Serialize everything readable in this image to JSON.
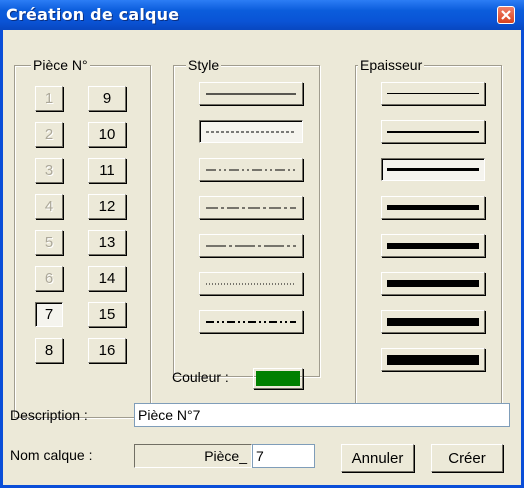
{
  "window": {
    "title": "Création de calque",
    "close_icon": "close-icon"
  },
  "piece": {
    "legend": "Pièce N°",
    "buttons": [
      {
        "label": "1",
        "disabled": true
      },
      {
        "label": "9",
        "disabled": false
      },
      {
        "label": "2",
        "disabled": true
      },
      {
        "label": "10",
        "disabled": false
      },
      {
        "label": "3",
        "disabled": true
      },
      {
        "label": "11",
        "disabled": false
      },
      {
        "label": "4",
        "disabled": true
      },
      {
        "label": "12",
        "disabled": false
      },
      {
        "label": "5",
        "disabled": true
      },
      {
        "label": "13",
        "disabled": false
      },
      {
        "label": "6",
        "disabled": true
      },
      {
        "label": "14",
        "disabled": false
      },
      {
        "label": "7",
        "disabled": false,
        "selected": true
      },
      {
        "label": "15",
        "disabled": false
      },
      {
        "label": "8",
        "disabled": false
      },
      {
        "label": "16",
        "disabled": false
      }
    ]
  },
  "style": {
    "legend": "Style",
    "options": [
      "solid",
      "dashed",
      "dash-dot-dot-long",
      "dash-dot",
      "long-dash-dot",
      "dotted",
      "dash-dot-dot-bold"
    ],
    "selected_index": 1
  },
  "epaisseur": {
    "legend": "Epaisseur",
    "options": [
      "1",
      "2",
      "3",
      "4",
      "5",
      "6",
      "7",
      "8"
    ],
    "selected_index": 2
  },
  "couleur": {
    "label": "Couleur :",
    "value": "#008000"
  },
  "description": {
    "label": "Description :",
    "value": "Pièce N°7"
  },
  "nom_calque": {
    "label": "Nom calque :",
    "prefix": "Pièce_",
    "value": "7"
  },
  "actions": {
    "cancel": "Annuler",
    "create": "Créer"
  }
}
